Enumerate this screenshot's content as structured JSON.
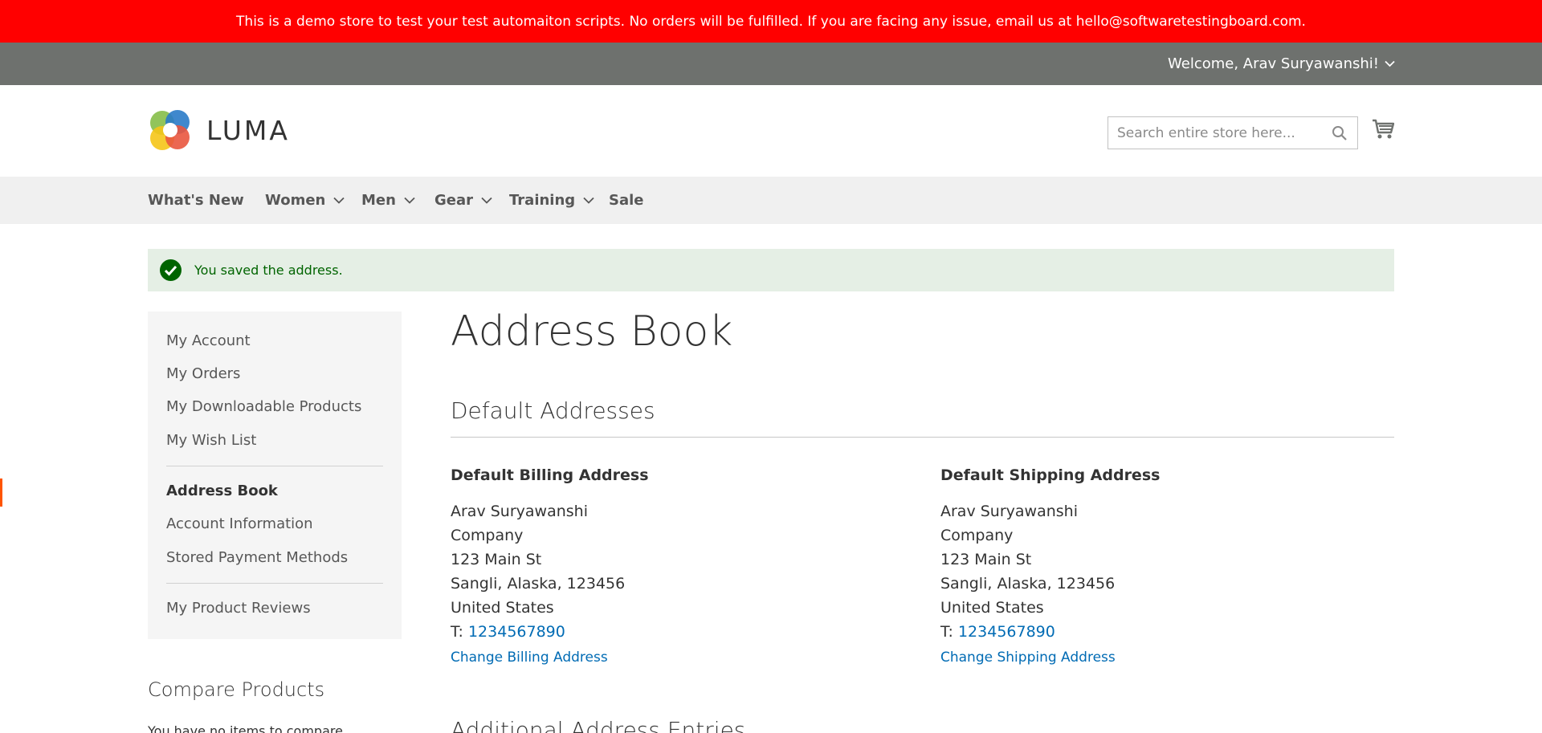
{
  "demo_banner": "This is a demo store to test your test automaiton scripts. No orders will be fulfilled. If you are facing any issue, email us at hello@softwaretestingboard.com.",
  "header": {
    "welcome": "Welcome, Arav Suryawanshi!"
  },
  "logo": {
    "text": "LUMA"
  },
  "search": {
    "placeholder": "Search entire store here..."
  },
  "nav": {
    "items": [
      {
        "label": "What's New",
        "has_dropdown": false
      },
      {
        "label": "Women",
        "has_dropdown": true
      },
      {
        "label": "Men",
        "has_dropdown": true
      },
      {
        "label": "Gear",
        "has_dropdown": true
      },
      {
        "label": "Training",
        "has_dropdown": true
      },
      {
        "label": "Sale",
        "has_dropdown": false
      }
    ]
  },
  "message": {
    "text": "You saved the address.",
    "type": "success"
  },
  "sidebar": {
    "items": [
      {
        "label": "My Account"
      },
      {
        "label": "My Orders"
      },
      {
        "label": "My Downloadable Products"
      },
      {
        "label": "My Wish List"
      },
      {
        "label": "Address Book",
        "active": true
      },
      {
        "label": "Account Information"
      },
      {
        "label": "Stored Payment Methods"
      },
      {
        "label": "My Product Reviews"
      }
    ]
  },
  "compare": {
    "title": "Compare Products",
    "empty_text": "You have no items to compare."
  },
  "main": {
    "title": "Address Book",
    "default_section_title": "Default Addresses",
    "additional_section_title": "Additional Address Entries",
    "billing": {
      "title": "Default Billing Address",
      "name": "Arav Suryawanshi",
      "company": "Company",
      "street": "123 Main St",
      "city_line": "Sangli, Alaska, 123456",
      "country": "United States",
      "phone_prefix": "T:",
      "phone": "1234567890",
      "link": "Change Billing Address"
    },
    "shipping": {
      "title": "Default Shipping Address",
      "name": "Arav Suryawanshi",
      "company": "Company",
      "street": "123 Main St",
      "city_line": "Sangli, Alaska, 123456",
      "country": "United States",
      "phone_prefix": "T:",
      "phone": "1234567890",
      "link": "Change Shipping Address"
    }
  },
  "colors": {
    "banner": "#ff0000",
    "header_bar": "#6e716e",
    "link": "#006bb4",
    "success_bg": "#e5efe5",
    "success_text": "#006400",
    "active_marker": "#ff5501"
  },
  "icons": [
    "chevron-down-icon",
    "luma-logo-icon",
    "search-icon",
    "cart-icon",
    "checkmark-icon"
  ]
}
